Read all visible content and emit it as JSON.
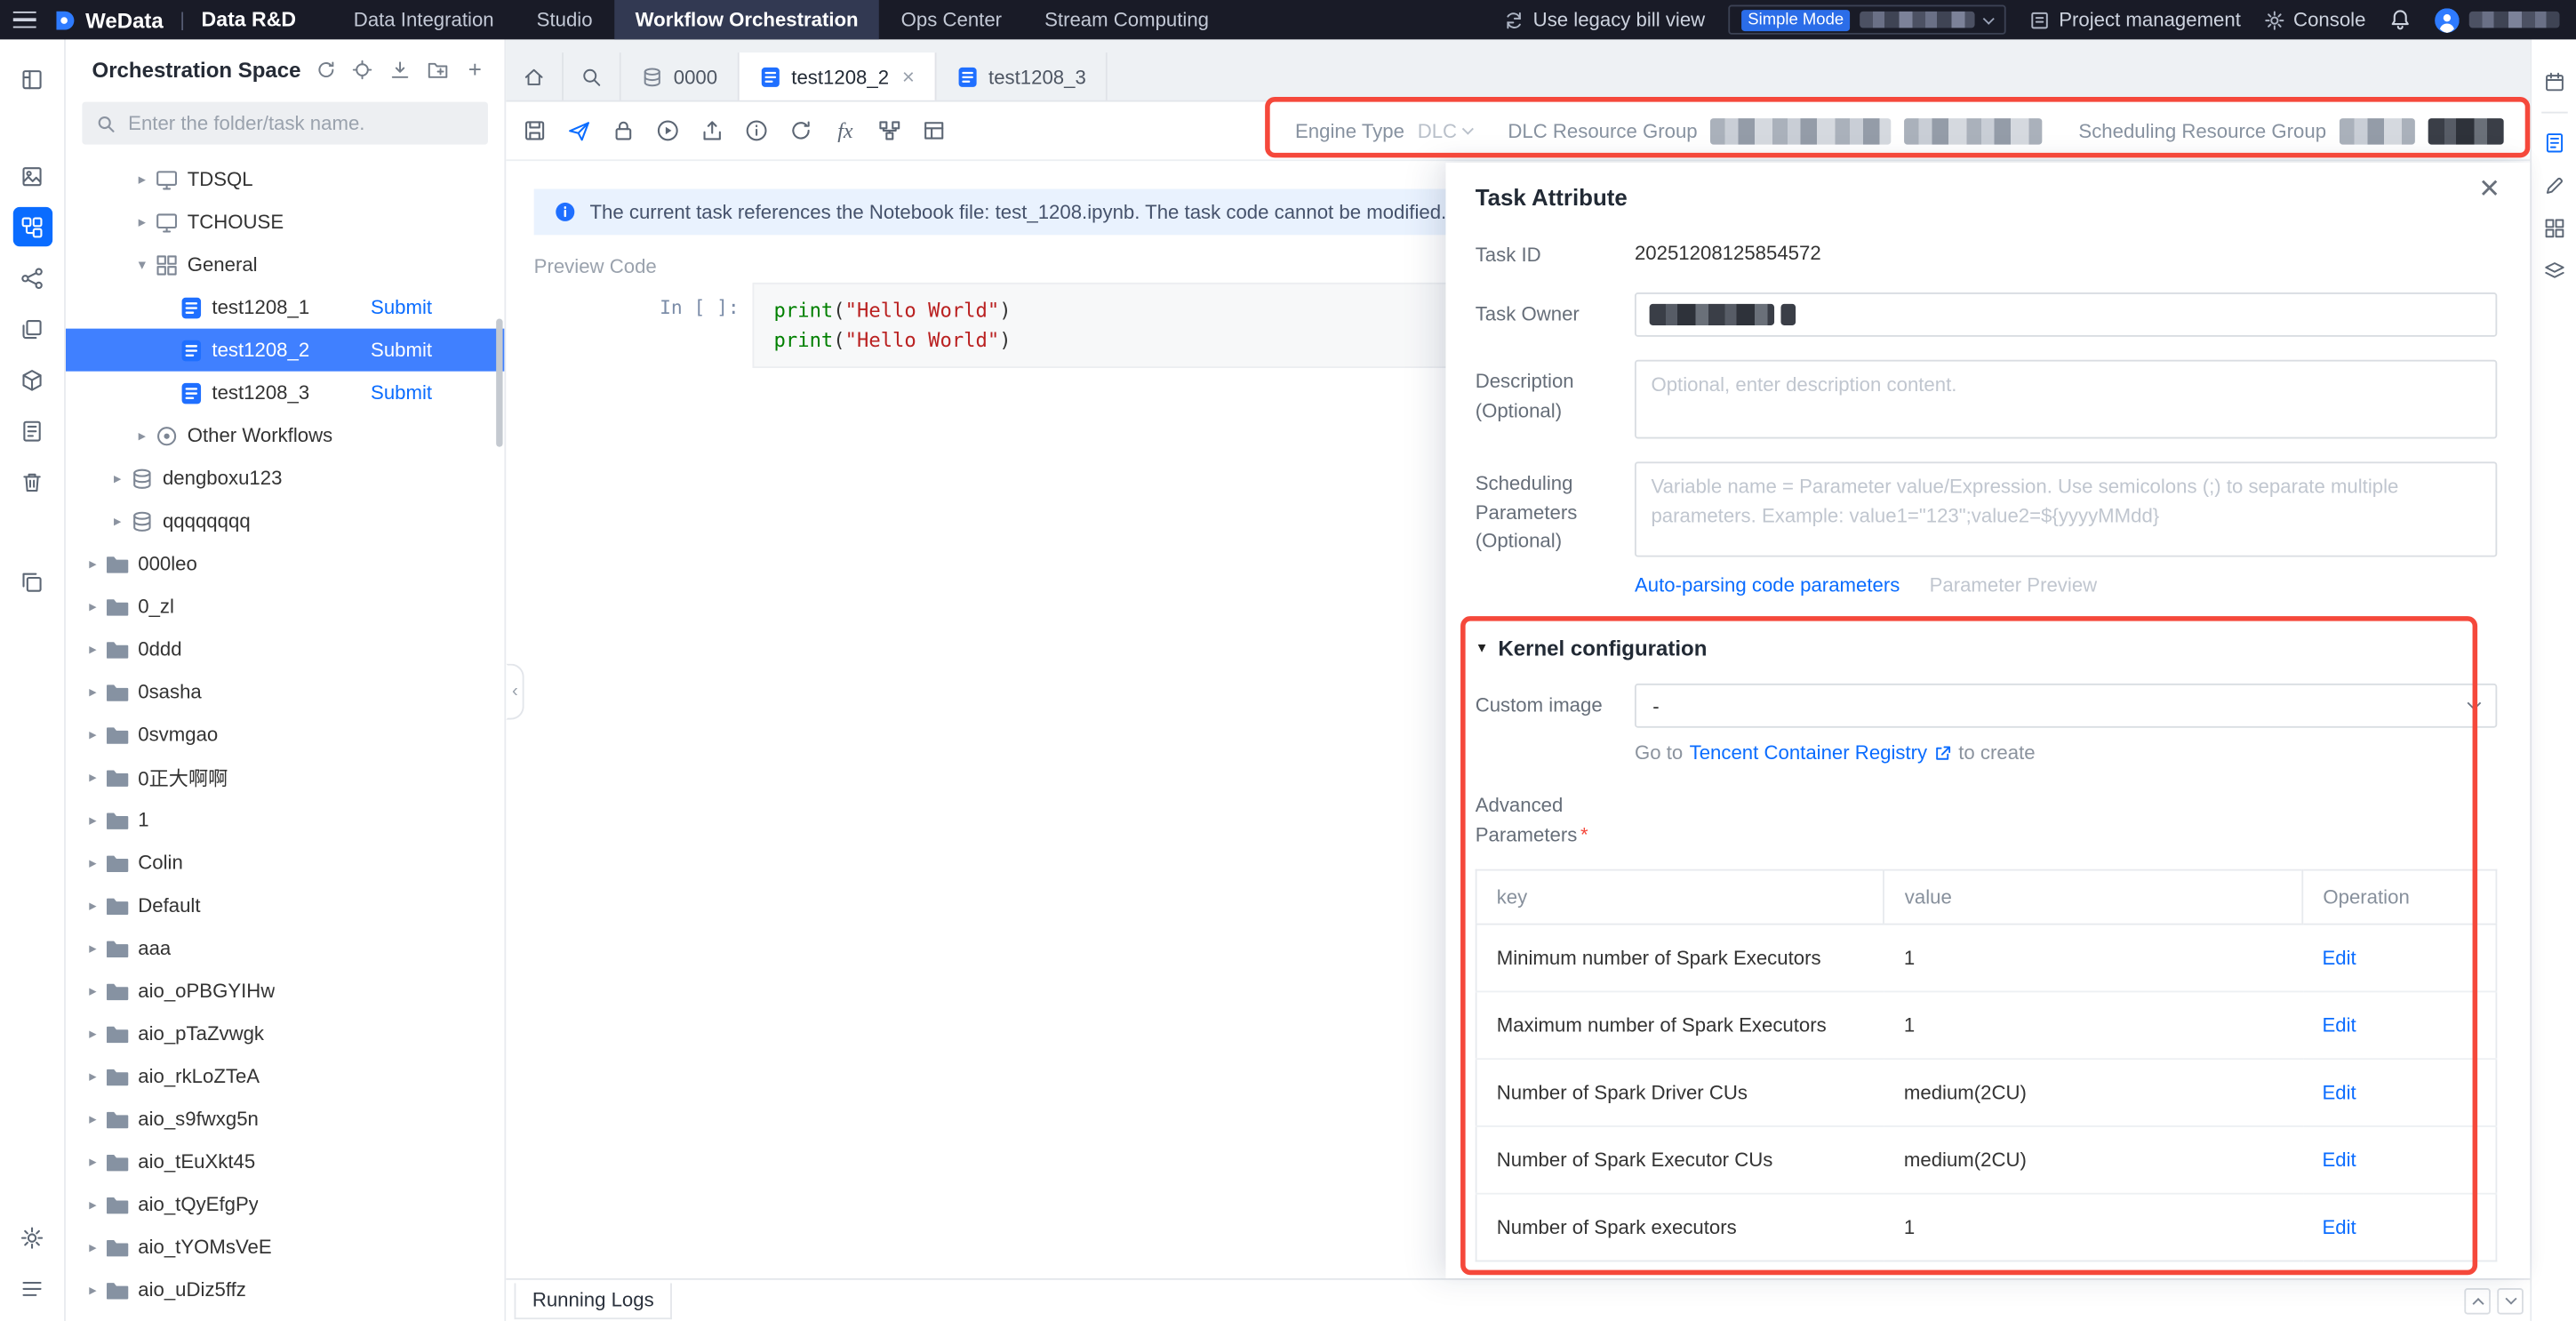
{
  "navbar": {
    "brand": "WeData",
    "product": "Data R&D",
    "menu": [
      {
        "label": "Data Integration",
        "active": false
      },
      {
        "label": "Studio",
        "active": false
      },
      {
        "label": "Workflow Orchestration",
        "active": true
      },
      {
        "label": "Ops Center",
        "active": false
      },
      {
        "label": "Stream Computing",
        "active": false
      }
    ],
    "legacy_link": "Use legacy bill view",
    "mode_badge": "Simple Mode",
    "project_management": "Project management",
    "console": "Console"
  },
  "sidebar": {
    "title": "Orchestration Space",
    "search_placeholder": "Enter the folder/task name.",
    "tree": [
      {
        "label": "TDSQL",
        "level": 3,
        "type": "screen",
        "arrow": "collapsed"
      },
      {
        "label": "TCHOUSE",
        "level": 3,
        "type": "screen",
        "arrow": "collapsed"
      },
      {
        "label": "General",
        "level": 3,
        "type": "grid",
        "arrow": "expanded"
      },
      {
        "label": "test1208_1",
        "level": 4,
        "type": "nb",
        "action": "Submit"
      },
      {
        "label": "test1208_2",
        "level": 4,
        "type": "nb",
        "action": "Submit",
        "selected": true
      },
      {
        "label": "test1208_3",
        "level": 4,
        "type": "nb",
        "action": "Submit"
      },
      {
        "label": "Other Workflows",
        "level": 3,
        "type": "circle",
        "arrow": "collapsed"
      },
      {
        "label": "dengboxu123",
        "level": 2,
        "type": "db",
        "arrow": "collapsed"
      },
      {
        "label": "qqqqqqqq",
        "level": 2,
        "type": "db",
        "arrow": "collapsed"
      },
      {
        "label": "000leo",
        "level": 1,
        "type": "folder",
        "arrow": "collapsed"
      },
      {
        "label": "0_zl",
        "level": 1,
        "type": "folder",
        "arrow": "collapsed"
      },
      {
        "label": "0ddd",
        "level": 1,
        "type": "folder",
        "arrow": "collapsed"
      },
      {
        "label": "0sasha",
        "level": 1,
        "type": "folder",
        "arrow": "collapsed"
      },
      {
        "label": "0svmgao",
        "level": 1,
        "type": "folder",
        "arrow": "collapsed"
      },
      {
        "label": "0正大啊啊",
        "level": 1,
        "type": "folder",
        "arrow": "collapsed"
      },
      {
        "label": "1",
        "level": 1,
        "type": "folder",
        "arrow": "collapsed"
      },
      {
        "label": "Colin",
        "level": 1,
        "type": "folder",
        "arrow": "collapsed"
      },
      {
        "label": "Default",
        "level": 1,
        "type": "folder",
        "arrow": "collapsed"
      },
      {
        "label": "aaa",
        "level": 1,
        "type": "folder",
        "arrow": "collapsed"
      },
      {
        "label": "aio_oPBGYIHw",
        "level": 1,
        "type": "folder",
        "arrow": "collapsed"
      },
      {
        "label": "aio_pTaZvwgk",
        "level": 1,
        "type": "folder",
        "arrow": "collapsed"
      },
      {
        "label": "aio_rkLoZTeA",
        "level": 1,
        "type": "folder",
        "arrow": "collapsed"
      },
      {
        "label": "aio_s9fwxg5n",
        "level": 1,
        "type": "folder",
        "arrow": "collapsed"
      },
      {
        "label": "aio_tEuXkt45",
        "level": 1,
        "type": "folder",
        "arrow": "collapsed"
      },
      {
        "label": "aio_tQyEfgPy",
        "level": 1,
        "type": "folder",
        "arrow": "collapsed"
      },
      {
        "label": "aio_tYOMsVeE",
        "level": 1,
        "type": "folder",
        "arrow": "collapsed"
      },
      {
        "label": "aio_uDiz5ffz",
        "level": 1,
        "type": "folder",
        "arrow": "collapsed"
      }
    ]
  },
  "tabs": [
    {
      "kind": "home"
    },
    {
      "kind": "search"
    },
    {
      "kind": "doc",
      "label": "0000",
      "icon": "db"
    },
    {
      "kind": "doc",
      "label": "test1208_2",
      "icon": "nb",
      "active": true,
      "closable": true
    },
    {
      "kind": "doc",
      "label": "test1208_3",
      "icon": "nb"
    }
  ],
  "toolbar": {
    "engine_type_label": "Engine Type",
    "engine_value": "DLC",
    "dlc_group_label": "DLC Resource Group",
    "sched_group_label": "Scheduling Resource Group"
  },
  "banner": {
    "text": "The current task references the Notebook file: test_1208.ipynb. The task code cannot be modified. If modification is nee"
  },
  "editor": {
    "preview_label": "Preview Code",
    "prompt": "In [ ]:",
    "code_fn": "print",
    "code_open": "(",
    "code_str": "\"Hello World\"",
    "code_close": ")"
  },
  "bottom_bar": {
    "running_logs": "Running Logs"
  },
  "panel": {
    "title": "Task Attribute",
    "task_id_label": "Task ID",
    "task_id": "20251208125854572",
    "owner_label": "Task Owner",
    "desc_label": "Description",
    "optional": "(Optional)",
    "desc_placeholder": "Optional, enter description content.",
    "sched_label": "Scheduling Parameters",
    "sched_placeholder": "Variable name = Parameter value/Expression. Use semicolons (;) to separate multiple parameters. Example: value1=\"123\";value2=${yyyyMMdd}",
    "autoparse_link": "Auto-parsing code parameters",
    "param_preview": "Parameter Preview",
    "kernel_title": "Kernel configuration",
    "custom_image_label": "Custom image",
    "custom_image_value": "-",
    "registry_prefix": "Go to",
    "registry_link": "Tencent Container Registry",
    "registry_suffix": "to create",
    "advanced_label": "Advanced Parameters",
    "required_mark": "*",
    "table": {
      "headers": [
        "key",
        "value",
        "Operation"
      ],
      "edit_label": "Edit",
      "rows": [
        [
          "Minimum number of Spark Executors",
          "1",
          "Edit"
        ],
        [
          "Maximum number of Spark Executors",
          "1",
          "Edit"
        ],
        [
          "Number of Spark Driver CUs",
          "medium(2CU)",
          "Edit"
        ],
        [
          "Number of Spark Executor CUs",
          "medium(2CU)",
          "Edit"
        ],
        [
          "Number of Spark executors",
          "1",
          "Edit"
        ]
      ]
    }
  },
  "colors": {
    "accent": "#0a6cff",
    "annotation": "#f5483b",
    "selected_row": "#4080ff",
    "navbar_bg": "#191b27",
    "banner_bg": "#e9f2fe"
  }
}
